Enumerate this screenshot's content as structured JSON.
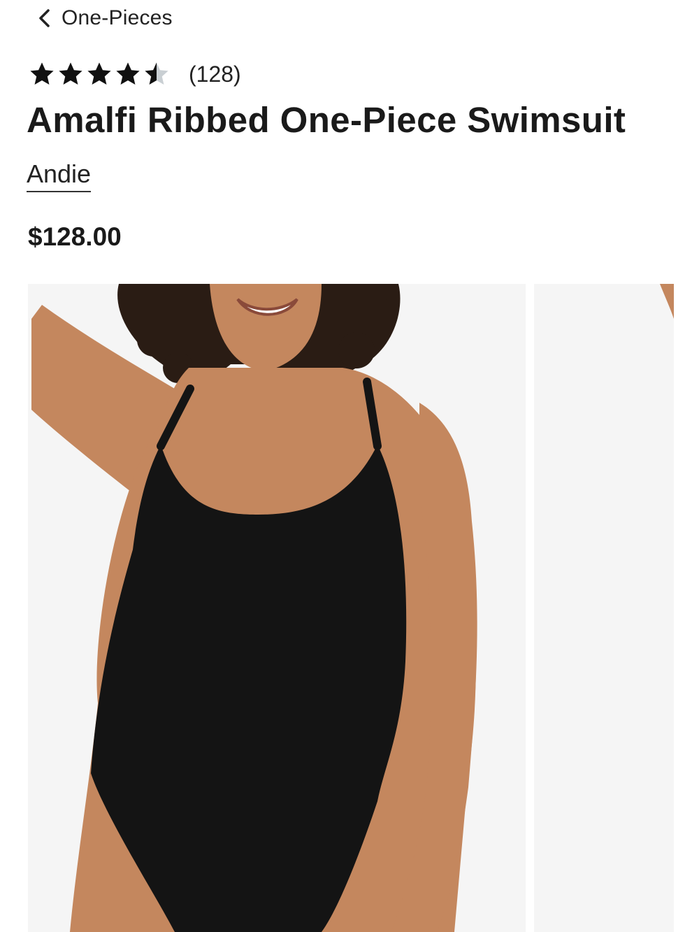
{
  "nav": {
    "back_label": "One-Pieces"
  },
  "product": {
    "rating": {
      "value": 4.5,
      "max": 5,
      "count_label": "(128)"
    },
    "title": "Amalfi Ribbed One-Piece Swimsuit",
    "brand": "Andie",
    "price": "$128.00"
  },
  "colors": {
    "text": "#1a1a1a",
    "star_filled": "#111111",
    "star_empty": "#c9cfd3",
    "image_bg": "#f5f5f5",
    "swimsuit": "#141414",
    "skin": "#c4875e"
  }
}
